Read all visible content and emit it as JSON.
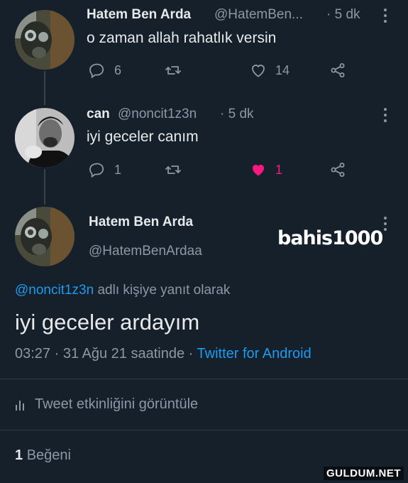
{
  "tweet1": {
    "name": "Hatem Ben Arda",
    "handle": "@HatemBen...",
    "time": "· 5 dk",
    "text": "o zaman allah rahatlık versin",
    "replies": "6",
    "likes": "14"
  },
  "tweet2": {
    "name": "can",
    "handle": "@noncit1z3n",
    "time": "· 5 dk",
    "text": "iyi geceler canım",
    "replies": "1",
    "likes": "1"
  },
  "main": {
    "name": "Hatem Ben Arda",
    "handle": "@HatemBenArdaa",
    "watermark": "bahis1000",
    "reply_to_handle": "@noncit1z3n",
    "reply_to_suffix": "adlı kişiye yanıt olarak",
    "text": "iyi geceler ardayım",
    "timestamp": "03:27 · 31 Ağu 21 saatinde ·",
    "client": "Twitter for Android",
    "activity_label": "Tweet etkinliğini görüntüle",
    "likes_count": "1",
    "likes_label": "Beğeni"
  },
  "site_watermark": "GULDUM.NET",
  "colors": {
    "background": "#15202b",
    "link": "#1d9bf0",
    "like_active": "#f91880",
    "secondary_text": "#8b98a5"
  }
}
